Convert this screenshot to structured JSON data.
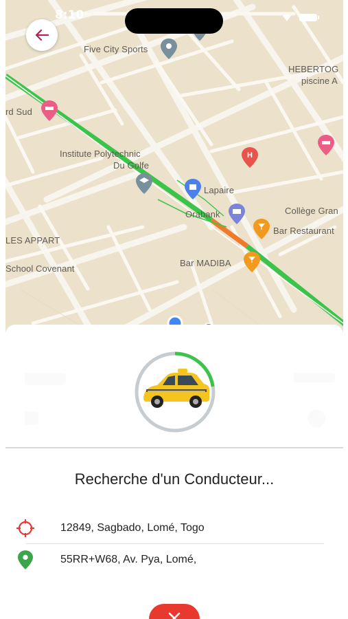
{
  "status_bar": {
    "time": "8:10"
  },
  "map": {
    "labels": {
      "five_city_sports": "Five City Sports",
      "hebertog": "HEBERTOG",
      "piscine": "piscine A",
      "rd_sud": "rd Sud",
      "polytechnic_1": "Institute Polytechnic",
      "polytechnic_2": "Du Golfe",
      "lapaire": "Lapaire",
      "orabank": "Orabank",
      "college": "Collège Gran",
      "bar_restaurant": "Bar Restaurant",
      "les_appart": "LES APPART",
      "school_covenant": "School Covenant",
      "bar_madiba": "Bar MADIBA"
    },
    "colors": {
      "route": "#3cc44a",
      "route_traffic": "#f07a2c",
      "land": "#ece2cc",
      "road": "#f7f3ea"
    }
  },
  "sheet": {
    "status_title": "Recherche d'un Conducteur...",
    "pickup": "12849, Sagbado, Lomé, Togo",
    "destination": "55RR+W68, Av. Pya, Lomé,",
    "colors": {
      "pickup_icon": "#e53935",
      "destination_icon": "#3aa54b",
      "cancel": "#e8392f",
      "progress": "#3cc44a"
    }
  }
}
